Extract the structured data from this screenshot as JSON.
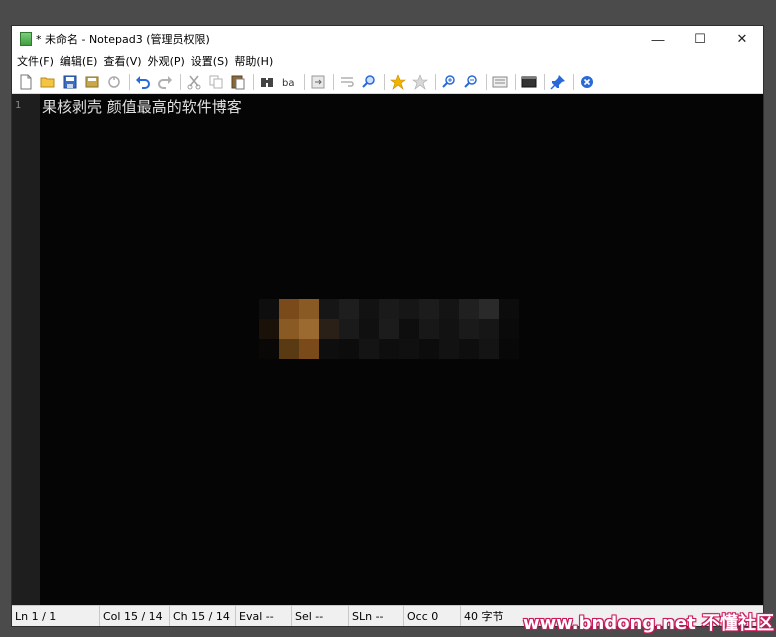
{
  "window": {
    "title": "* 未命名 - Notepad3  (管理员权限)",
    "controls": {
      "minimize": "—",
      "maximize": "☐",
      "close": "✕"
    }
  },
  "menu": [
    {
      "label": "文件(F)"
    },
    {
      "label": "编辑(E)"
    },
    {
      "label": "查看(V)"
    },
    {
      "label": "外观(P)"
    },
    {
      "label": "设置(S)"
    },
    {
      "label": "帮助(H)"
    }
  ],
  "toolbar": {
    "icons": [
      "new-file-icon",
      "open-folder-icon",
      "save-icon",
      "save-as-icon",
      "revert-icon",
      "undo-icon",
      "redo-icon",
      "cut-icon",
      "copy-icon",
      "paste-icon",
      "find-icon",
      "replace-icon",
      "goto-icon",
      "wordwrap-icon",
      "zoom-text-icon",
      "favorites-icon",
      "add-favorite-icon",
      "zoom-in-icon",
      "zoom-out-icon",
      "view-scheme-icon",
      "terminal-icon",
      "pin-icon",
      "exit-icon"
    ]
  },
  "editor": {
    "line_numbers": [
      "1"
    ],
    "lines": [
      "果核剥壳 颜值最高的软件博客"
    ],
    "background": "#050505",
    "text_color": "#e0e0e0"
  },
  "statusbar": {
    "ln": "Ln  1 / 1",
    "col": "Col  15 / 14",
    "ch": "Ch  15 / 14",
    "eval": "Eval  --",
    "sel": "Sel  --",
    "sln": "SLn  --",
    "occ": "Occ  0",
    "bytes": "40 字节"
  },
  "watermark": "www.bndong.net 不懂社区",
  "colors": {
    "accent_star": "#f2b400",
    "undo_blue": "#2a6ad8",
    "watermark_pink": "#c8195a"
  }
}
